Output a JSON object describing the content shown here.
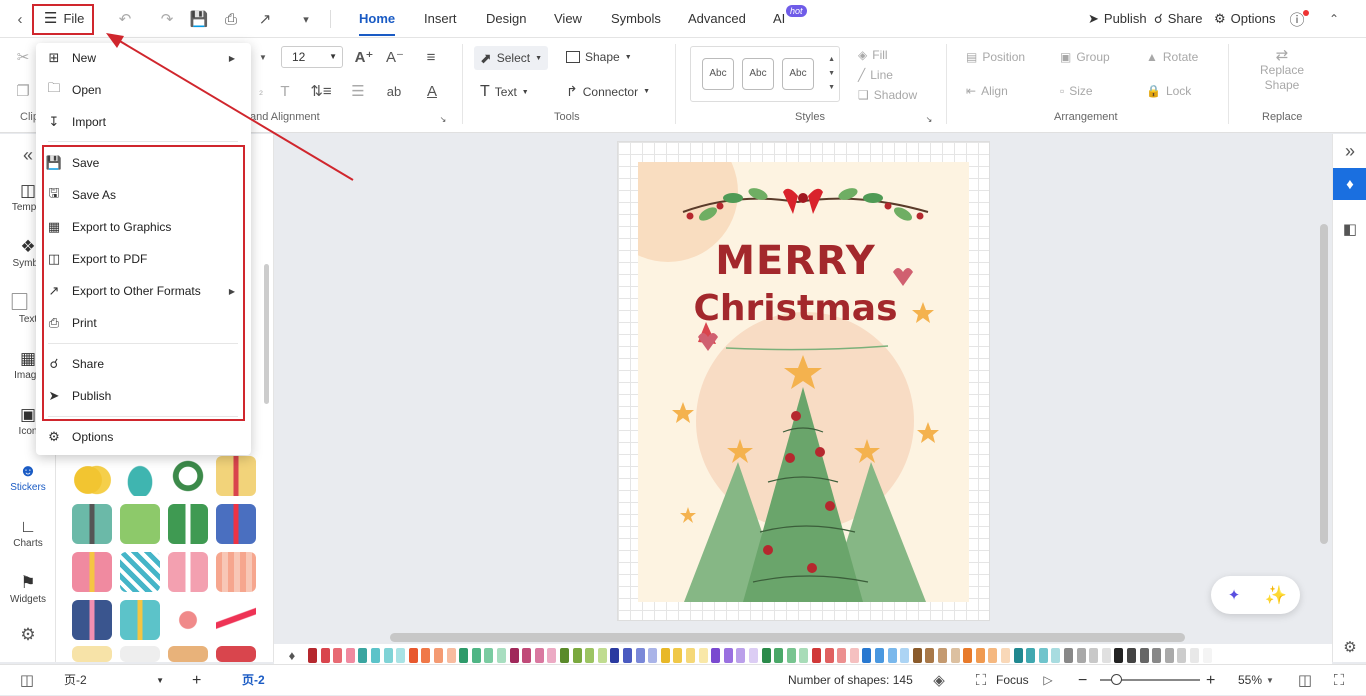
{
  "titlebar": {
    "file_label": "File",
    "tabs": [
      "Home",
      "Insert",
      "Design",
      "View",
      "Symbols",
      "Advanced",
      "AI"
    ],
    "ai_badge": "hot",
    "publish": "Publish",
    "share": "Share",
    "options": "Options"
  },
  "ribbon": {
    "font_size": "12",
    "select": "Select",
    "shape": "Shape",
    "text": "Text",
    "connector": "Connector",
    "style_sample": "Abc",
    "fill": "Fill",
    "line": "Line",
    "shadow": "Shadow",
    "position": "Position",
    "group": "Group",
    "rotate": "Rotate",
    "align": "Align",
    "size": "Size",
    "lock": "Lock",
    "replace_shape_1": "Replace",
    "replace_shape_2": "Shape",
    "group_clip": "Clip",
    "group_font": "and Alignment",
    "group_tools": "Tools",
    "group_styles": "Styles",
    "group_arrangement": "Arrangement",
    "group_replace": "Replace"
  },
  "leftbar": {
    "items": [
      "Templa",
      "Symbo",
      "Text",
      "Image",
      "Icon",
      "Stickers",
      "Charts",
      "Widgets"
    ]
  },
  "file_menu": {
    "items": [
      "New",
      "Open",
      "Import",
      "Save",
      "Save As",
      "Export to Graphics",
      "Export to PDF",
      "Export to Other Formats",
      "Print",
      "Share",
      "Publish",
      "Options"
    ]
  },
  "card": {
    "line1": "MERRY",
    "line2": "Christmas"
  },
  "status": {
    "page_selector": "页-2",
    "page_tab": "页-2",
    "shapes": "Number of shapes: 145",
    "focus": "Focus",
    "zoom": "55%"
  },
  "colors": {
    "accent": "#1a5bc4",
    "highlight": "#d0262d",
    "card_bg": "#fdf3e1",
    "tree": "#7bb07a",
    "text_red": "#a3282c"
  }
}
